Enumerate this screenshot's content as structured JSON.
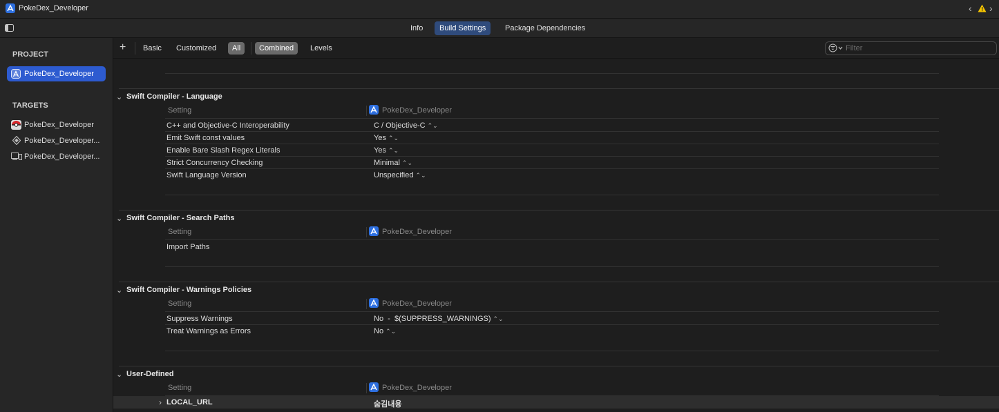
{
  "window": {
    "title": "PokeDex_Developer"
  },
  "tabs": [
    {
      "label": "Info"
    },
    {
      "label": "Build Settings",
      "active": true
    },
    {
      "label": "Package Dependencies"
    }
  ],
  "sidebar": {
    "project_header": "PROJECT",
    "project": "PokeDex_Developer",
    "targets_header": "TARGETS",
    "targets": [
      {
        "label": "PokeDex_Developer",
        "icon": "pokeball-app-icon"
      },
      {
        "label": "PokeDex_Developer...",
        "icon": "test-diamond-icon"
      },
      {
        "label": "PokeDex_Developer...",
        "icon": "ui-test-icon"
      }
    ]
  },
  "filterbar": {
    "add": "+",
    "buttons": [
      "Basic",
      "Customized",
      "All",
      "Combined",
      "Levels"
    ],
    "selected": [
      "All",
      "Combined"
    ],
    "filter_placeholder": "Filter"
  },
  "groups": [
    {
      "title": "Swift Compiler - Language",
      "col_setting": "Setting",
      "col_project": "PokeDex_Developer",
      "rows": [
        {
          "name": "C++ and Objective-C Interoperability",
          "value": "C / Objective-C"
        },
        {
          "name": "Emit Swift const values",
          "value": "Yes"
        },
        {
          "name": "Enable Bare Slash Regex Literals",
          "value": "Yes"
        },
        {
          "name": "Strict Concurrency Checking",
          "value": "Minimal"
        },
        {
          "name": "Swift Language Version",
          "value": "Unspecified"
        }
      ]
    },
    {
      "title": "Swift Compiler - Search Paths",
      "col_setting": "Setting",
      "col_project": "PokeDex_Developer",
      "rows": [
        {
          "name": "Import Paths",
          "value": ""
        }
      ]
    },
    {
      "title": "Swift Compiler - Warnings Policies",
      "col_setting": "Setting",
      "col_project": "PokeDex_Developer",
      "rows": [
        {
          "name": "Suppress Warnings",
          "value": "No  -  $(SUPPRESS_WARNINGS)"
        },
        {
          "name": "Treat Warnings as Errors",
          "value": "No"
        }
      ]
    },
    {
      "title": "User-Defined",
      "col_setting": "Setting",
      "col_project": "PokeDex_Developer",
      "rows": [
        {
          "name": "LOCAL_URL",
          "value": "숨김내용"
        }
      ]
    }
  ],
  "colors": {
    "accent": "#2d5bd0",
    "active_tab": "#2f4b7c",
    "warning": "#f5c400"
  }
}
